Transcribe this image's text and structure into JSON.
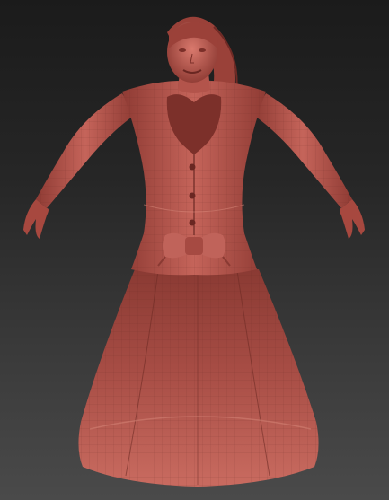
{
  "viewport": {
    "background_top": "#1b1b1b",
    "background_bottom": "#4a4a4a"
  },
  "model": {
    "material_color": "#b85a52",
    "shadow_color": "#7a2f2a",
    "highlight_color": "#e08a7c",
    "parts_icon_names": [
      "head-icon",
      "hair-icon",
      "jacket-icon",
      "skirt-icon",
      "bow-icon",
      "button-icon",
      "hand-icon"
    ]
  }
}
